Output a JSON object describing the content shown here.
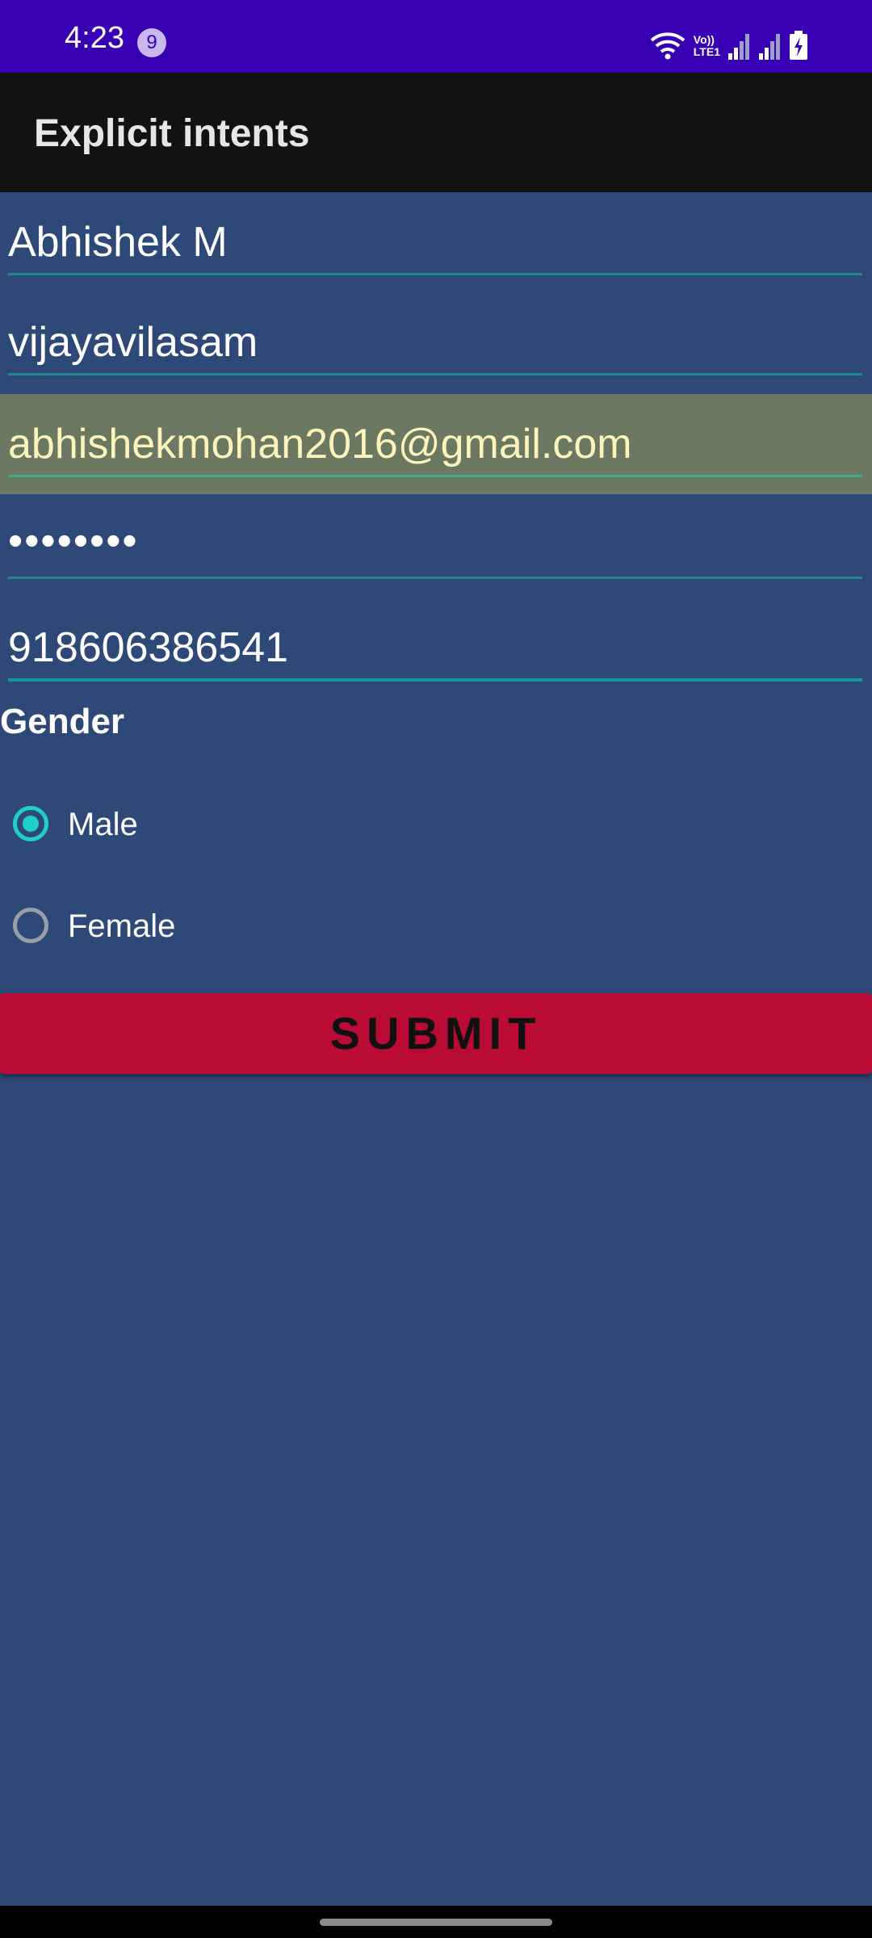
{
  "status_bar": {
    "time": "4:23",
    "notification_count": "9",
    "volte_line1": "Vo))",
    "volte_line2": "LTE1",
    "background": "#3700b3"
  },
  "app_bar": {
    "title": "Explicit intents"
  },
  "form": {
    "name": "Abhishek M",
    "address": "vijayavilasam",
    "email": "abhishekmohan2016@gmail.com",
    "password": "••••••••",
    "phone": "918606386541",
    "gender_label": "Gender",
    "gender_options": [
      {
        "label": "Male",
        "selected": true
      },
      {
        "label": "Female",
        "selected": false
      }
    ],
    "submit_label": "SUBMIT"
  },
  "colors": {
    "background": "#2e4877",
    "accent": "#20d0c8",
    "submit": "#b90b33",
    "email_highlight": "#6b7862"
  },
  "icons": {
    "wifi": "wifi-icon",
    "signal_1": "signal-icon",
    "signal_2": "signal-icon",
    "battery": "battery-charging-icon"
  }
}
